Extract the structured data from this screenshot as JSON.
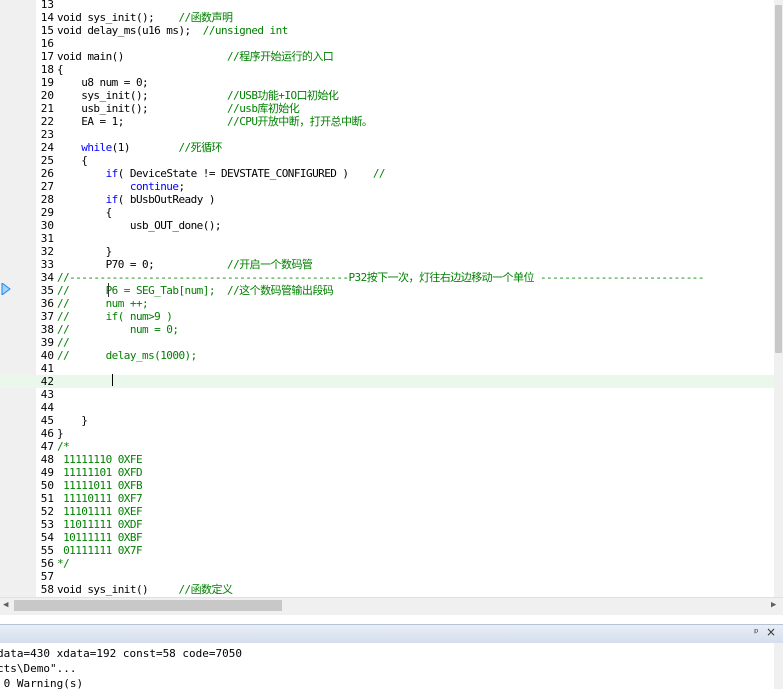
{
  "editor": {
    "current_line_index": 29,
    "lines": [
      {
        "n": "13",
        "segs": []
      },
      {
        "n": "14",
        "segs": [
          {
            "t": "void sys_init();    ",
            "c": ""
          },
          {
            "t": "//函数声明",
            "c": "cm"
          }
        ]
      },
      {
        "n": "15",
        "segs": [
          {
            "t": "void delay_ms(u16 ms);  ",
            "c": ""
          },
          {
            "t": "//unsigned int",
            "c": "cm"
          }
        ]
      },
      {
        "n": "16",
        "segs": []
      },
      {
        "n": "17",
        "segs": [
          {
            "t": "void main()                 ",
            "c": ""
          },
          {
            "t": "//程序开始运行的入口",
            "c": "cm"
          }
        ]
      },
      {
        "n": "18",
        "segs": [
          {
            "t": "{",
            "c": ""
          }
        ]
      },
      {
        "n": "19",
        "segs": [
          {
            "t": "    u8 num = 0;",
            "c": ""
          }
        ]
      },
      {
        "n": "20",
        "segs": [
          {
            "t": "    sys_init();             ",
            "c": ""
          },
          {
            "t": "//USB功能+IO口初始化",
            "c": "cm"
          }
        ]
      },
      {
        "n": "21",
        "segs": [
          {
            "t": "    usb_init();             ",
            "c": ""
          },
          {
            "t": "//usb库初始化",
            "c": "cm"
          }
        ]
      },
      {
        "n": "22",
        "segs": [
          {
            "t": "    EA = 1;                 ",
            "c": ""
          },
          {
            "t": "//CPU开放中断，打开总中断。",
            "c": "cm"
          }
        ]
      },
      {
        "n": "23",
        "segs": []
      },
      {
        "n": "24",
        "segs": [
          {
            "t": "    ",
            "c": ""
          },
          {
            "t": "while",
            "c": "kw"
          },
          {
            "t": "(1)        ",
            "c": ""
          },
          {
            "t": "//死循环",
            "c": "cm"
          }
        ]
      },
      {
        "n": "25",
        "segs": [
          {
            "t": "    {",
            "c": ""
          }
        ]
      },
      {
        "n": "26",
        "segs": [
          {
            "t": "        ",
            "c": ""
          },
          {
            "t": "if",
            "c": "kw"
          },
          {
            "t": "( DeviceState != DEVSTATE_CONFIGURED )    ",
            "c": ""
          },
          {
            "t": "//",
            "c": "cm"
          }
        ]
      },
      {
        "n": "27",
        "segs": [
          {
            "t": "            ",
            "c": ""
          },
          {
            "t": "continue",
            "c": "kw"
          },
          {
            "t": ";",
            "c": ""
          }
        ]
      },
      {
        "n": "28",
        "segs": [
          {
            "t": "        ",
            "c": ""
          },
          {
            "t": "if",
            "c": "kw"
          },
          {
            "t": "( bUsbOutReady )",
            "c": ""
          }
        ]
      },
      {
        "n": "29",
        "segs": [
          {
            "t": "        {",
            "c": ""
          }
        ]
      },
      {
        "n": "30",
        "segs": [
          {
            "t": "            usb_OUT_done();",
            "c": ""
          }
        ]
      },
      {
        "n": "31",
        "segs": []
      },
      {
        "n": "32",
        "segs": [
          {
            "t": "        }",
            "c": ""
          }
        ]
      },
      {
        "n": "33",
        "segs": [
          {
            "t": "        P70 = 0;            ",
            "c": ""
          },
          {
            "t": "//开启一个数码管",
            "c": "cm"
          }
        ]
      },
      {
        "n": "34",
        "segs": [
          {
            "t": "//----------------------------------------------P32按下一次，灯往右边边移动一个单位 ---------------------------",
            "c": "cm"
          }
        ]
      },
      {
        "n": "35",
        "segs": [
          {
            "t": "//      P6 = SEG_Tab[num];  //这个数码管输出段码",
            "c": "cm"
          }
        ]
      },
      {
        "n": "36",
        "segs": [
          {
            "t": "//      num ++;",
            "c": "cm"
          }
        ]
      },
      {
        "n": "37",
        "segs": [
          {
            "t": "//      if( num>9 )",
            "c": "cm"
          }
        ]
      },
      {
        "n": "38",
        "segs": [
          {
            "t": "//          num = 0;",
            "c": "cm"
          }
        ]
      },
      {
        "n": "39",
        "segs": [
          {
            "t": "//",
            "c": "cm"
          }
        ]
      },
      {
        "n": "40",
        "segs": [
          {
            "t": "//      delay_ms(1000);",
            "c": "cm"
          }
        ]
      },
      {
        "n": "41",
        "segs": []
      },
      {
        "n": "42",
        "segs": []
      },
      {
        "n": "43",
        "segs": []
      },
      {
        "n": "44",
        "segs": []
      },
      {
        "n": "45",
        "segs": [
          {
            "t": "    }",
            "c": ""
          }
        ]
      },
      {
        "n": "46",
        "segs": [
          {
            "t": "}",
            "c": ""
          }
        ]
      },
      {
        "n": "47",
        "segs": [
          {
            "t": "/*",
            "c": "cm"
          }
        ]
      },
      {
        "n": "48",
        "segs": [
          {
            "t": " 11111110 0XFE",
            "c": "cm"
          }
        ]
      },
      {
        "n": "49",
        "segs": [
          {
            "t": " 11111101 0XFD",
            "c": "cm"
          }
        ]
      },
      {
        "n": "50",
        "segs": [
          {
            "t": " 11111011 0XFB",
            "c": "cm"
          }
        ]
      },
      {
        "n": "51",
        "segs": [
          {
            "t": " 11110111 0XF7",
            "c": "cm"
          }
        ]
      },
      {
        "n": "52",
        "segs": [
          {
            "t": " 11101111 0XEF",
            "c": "cm"
          }
        ]
      },
      {
        "n": "53",
        "segs": [
          {
            "t": " 11011111 0XDF",
            "c": "cm"
          }
        ]
      },
      {
        "n": "54",
        "segs": [
          {
            "t": " 10111111 0XBF",
            "c": "cm"
          }
        ]
      },
      {
        "n": "55",
        "segs": [
          {
            "t": " 01111111 0X7F",
            "c": "cm"
          }
        ]
      },
      {
        "n": "56",
        "segs": [
          {
            "t": "*/",
            "c": "cm"
          }
        ]
      },
      {
        "n": "57",
        "segs": []
      },
      {
        "n": "58",
        "segs": [
          {
            "t": "void sys_init()     ",
            "c": ""
          },
          {
            "t": "//函数定义",
            "c": "cm"
          }
        ]
      }
    ]
  },
  "output": {
    "lines": [
      "data=430 xdata=192 const=58 code=7050",
      "cts\\Demo\"...",
      " 0 Warning(s)"
    ]
  },
  "panel": {
    "pin_icon": "pin-icon",
    "close_icon": "close-icon",
    "pin_glyph": "ᵖ",
    "close_glyph": "×"
  },
  "colors": {
    "keyword": "#0000ff",
    "comment": "#008000",
    "current_line": "#eaf8ec",
    "marker": "#1e88e5"
  }
}
